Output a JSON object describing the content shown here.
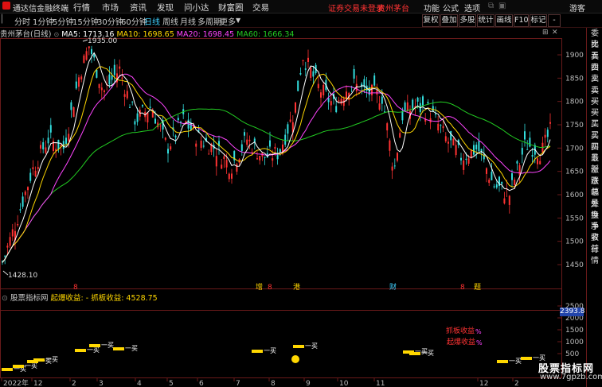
{
  "titlebar": {
    "app_title": "通达信金融终端",
    "menus": [
      "行情",
      "市场",
      "资讯",
      "发现",
      "问小达",
      "财富圈",
      "交易"
    ],
    "warning": "证券交易未登录",
    "stock_name": "贵州茅台",
    "right_menus": [
      "功能",
      "公式",
      "选项"
    ],
    "user": "游客"
  },
  "toolbar": {
    "periods": [
      "分时",
      "1分钟",
      "5分钟",
      "15分钟",
      "30分钟",
      "60分钟",
      "日线",
      "周线",
      "月线",
      "多周期",
      "更多"
    ],
    "active": "日线",
    "right_tabs": [
      "复权",
      "叠加",
      "多股",
      "统计",
      "画线",
      "F10",
      "标记",
      "-"
    ]
  },
  "chart_header": {
    "title": "贵州茅台(日线)",
    "ma5": "MA5: 1713.16",
    "ma10": "MA10: 1698.65",
    "ma20": "MA20: 1698.45",
    "ma60": "MA60: 1666.34"
  },
  "colors": {
    "ma5": "#ffffff",
    "ma10": "#ffd700",
    "ma20": "#ff44ff",
    "ma60": "#22cc22",
    "up": "#ff3333",
    "down": "#33dddd",
    "grid": "#6a1a1a"
  },
  "price_axis": {
    "ticks": [
      "1900",
      "1850",
      "1800",
      "1750",
      "1700",
      "1650",
      "1600",
      "1550",
      "1500",
      "1450"
    ],
    "high_label": "1935.00",
    "low_label": "1428.10"
  },
  "event_markers": [
    "8",
    "增",
    "8",
    "港",
    "财",
    "8",
    "题"
  ],
  "indicator": {
    "name": "股票指标网",
    "formula": "起爆收益: - 抓板收益: 4528.75",
    "value_box": "2393.8",
    "ticks": [
      "2500",
      "2000",
      "1500",
      "1000",
      "500"
    ],
    "legend1": "抓板收益",
    "legend2": "起爆收益",
    "legend_unit": "%",
    "label": "一买"
  },
  "time_axis": [
    "2022年",
    "12",
    "2",
    "3",
    "4",
    "5",
    "6",
    "7",
    "8",
    "9",
    "10",
    "11",
    "12",
    "2"
  ],
  "quote_column": [
    "委比",
    "卖五",
    "卖四",
    "卖三",
    "卖二",
    "卖一",
    "买一",
    "买二",
    "买三",
    "买四",
    "买五",
    "最新",
    "涨跌",
    "涨幅",
    "总量",
    "外盘",
    "换手",
    "净资",
    "收益",
    "行情"
  ],
  "watermark": {
    "name": "股票指标网",
    "url": "www.7gpzb.com"
  }
}
